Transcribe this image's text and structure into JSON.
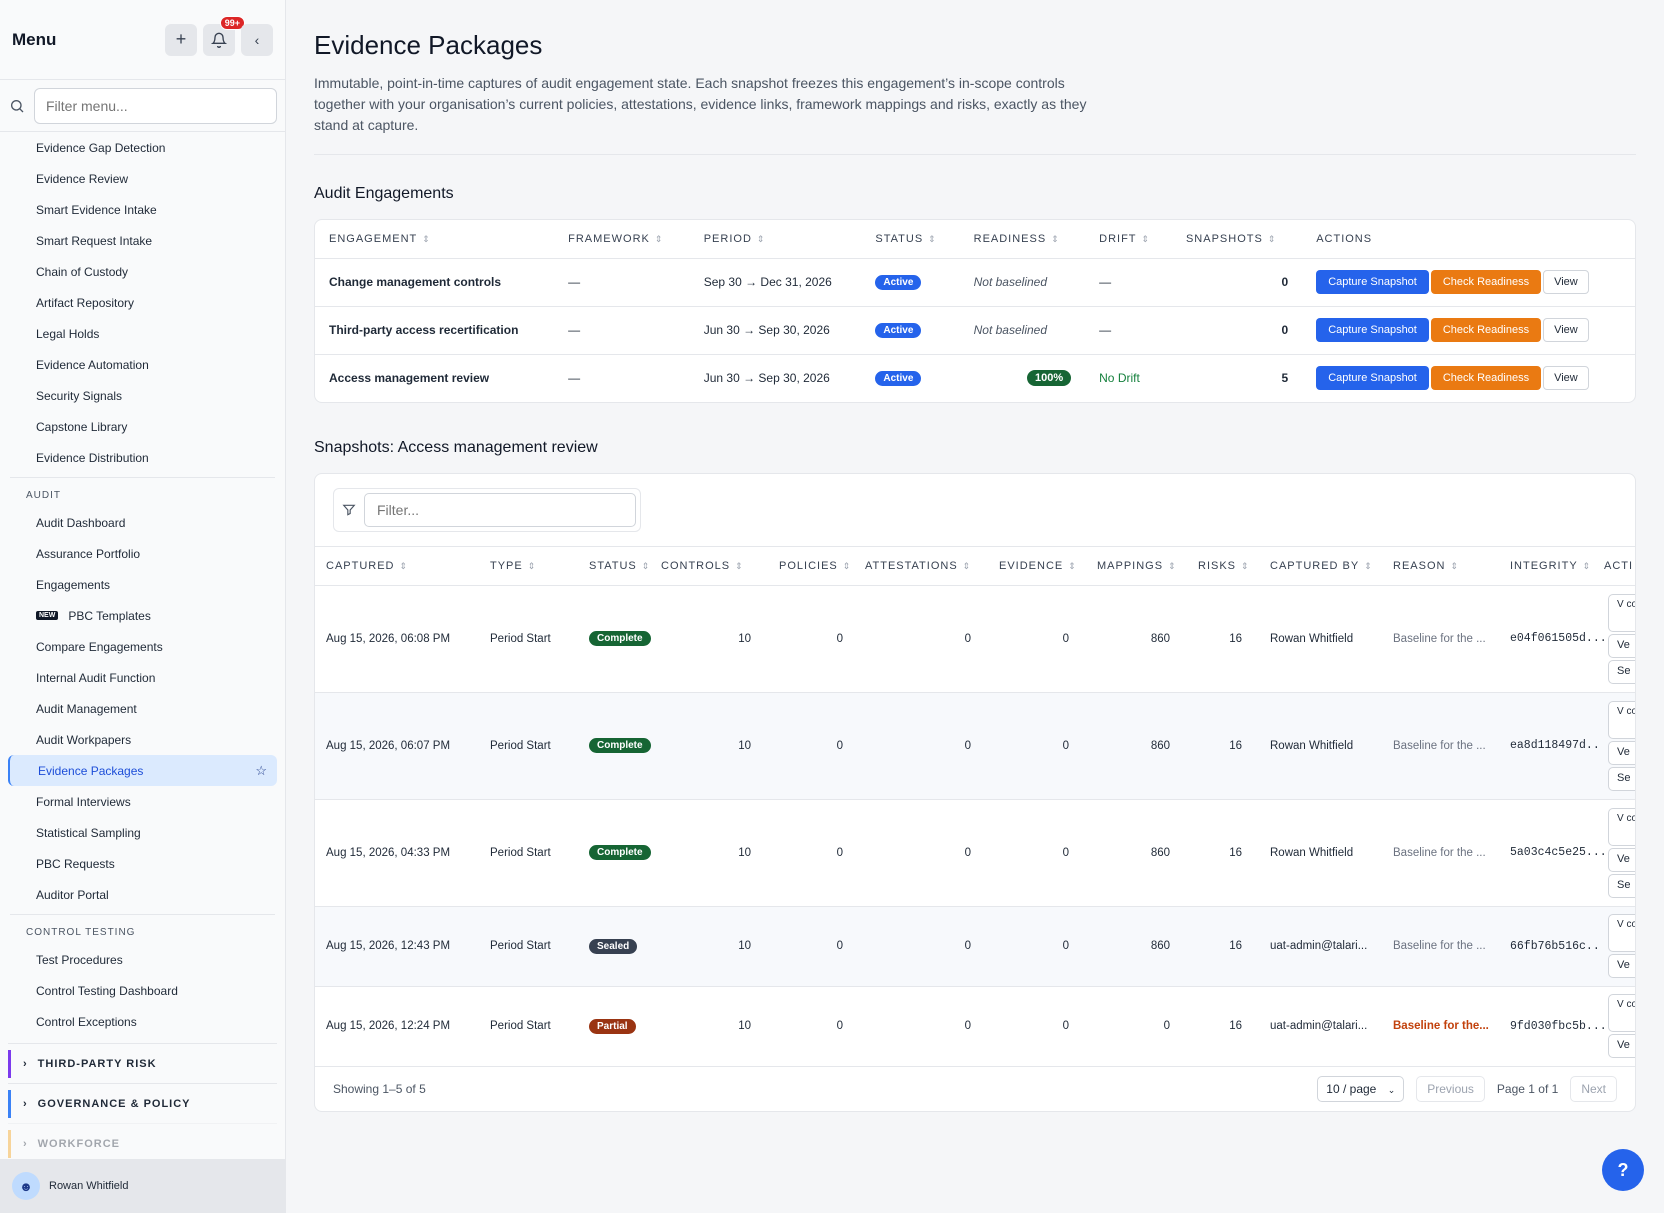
{
  "sidebar": {
    "title": "Menu",
    "badge": "99+",
    "search_placeholder": "Filter menu...",
    "items_top": [
      "Evidence Gap Detection",
      "Evidence Review",
      "Smart Evidence Intake",
      "Smart Request Intake",
      "Chain of Custody",
      "Artifact Repository",
      "Legal Holds",
      "Evidence Automation",
      "Security Signals",
      "Capstone Library",
      "Evidence Distribution"
    ],
    "audit_section": "AUDIT",
    "audit_items": [
      "Audit Dashboard",
      "Assurance Portfolio",
      "Engagements",
      "PBC Templates",
      "Compare Engagements",
      "Internal Audit Function",
      "Audit Management",
      "Audit Workpapers",
      "Evidence Packages",
      "Formal Interviews",
      "Statistical Sampling",
      "PBC Requests",
      "Auditor Portal"
    ],
    "new_tag": "NEW",
    "control_section": "CONTROL TESTING",
    "control_items": [
      "Test Procedures",
      "Control Testing Dashboard",
      "Control Exceptions"
    ],
    "groups": [
      "THIRD-PARTY RISK",
      "GOVERNANCE & POLICY",
      "WORKFORCE"
    ],
    "user": "Rowan Whitfield"
  },
  "page": {
    "title": "Evidence Packages",
    "description": "Immutable, point-in-time captures of audit engagement state. Each snapshot freezes this engagement’s in-scope controls together with your organisation’s current policies, attestations, evidence links, framework mappings and risks, exactly as they stand at capture."
  },
  "engagements": {
    "heading": "Audit Engagements",
    "columns": [
      "ENGAGEMENT",
      "FRAMEWORK",
      "PERIOD",
      "STATUS",
      "READINESS",
      "DRIFT",
      "SNAPSHOTS",
      "ACTIONS"
    ],
    "rows": [
      {
        "name": "Change management controls",
        "framework": "—",
        "period": "Sep 30 → Dec 31, 2026",
        "status": "Active",
        "readiness": "Not baselined",
        "drift": "—",
        "snapshots": "0"
      },
      {
        "name": "Third-party access recertification",
        "framework": "—",
        "period": "Jun 30 → Sep 30, 2026",
        "status": "Active",
        "readiness": "Not baselined",
        "drift": "—",
        "snapshots": "0"
      },
      {
        "name": "Access management review",
        "framework": "—",
        "period": "Jun 30 → Sep 30, 2026",
        "status": "Active",
        "readiness": "100%",
        "drift": "No Drift",
        "snapshots": "5"
      }
    ],
    "actions": {
      "capture": "Capture Snapshot",
      "check": "Check Readiness",
      "view": "View"
    }
  },
  "snapshots": {
    "heading": "Snapshots: Access management review",
    "filter_placeholder": "Filter...",
    "columns": [
      "CAPTURED",
      "TYPE",
      "STATUS",
      "CONTROLS",
      "POLICIES",
      "ATTESTATIONS",
      "EVIDENCE",
      "MAPPINGS",
      "RISKS",
      "CAPTURED BY",
      "REASON",
      "INTEGRITY",
      "ACTI"
    ],
    "rows": [
      {
        "captured": "Aug 15, 2026, 06:08 PM",
        "type": "Period Start",
        "status": "Complete",
        "controls": "10",
        "policies": "0",
        "attestations": "0",
        "evidence": "0",
        "mappings": "860",
        "risks": "16",
        "by": "Rowan Whitfield",
        "reason": "Baseline for the ...",
        "integrity": "e04f061505d...",
        "acts": [
          "V co",
          "Ve",
          "Se"
        ]
      },
      {
        "captured": "Aug 15, 2026, 06:07 PM",
        "type": "Period Start",
        "status": "Complete",
        "controls": "10",
        "policies": "0",
        "attestations": "0",
        "evidence": "0",
        "mappings": "860",
        "risks": "16",
        "by": "Rowan Whitfield",
        "reason": "Baseline for the ...",
        "integrity": "ea8d118497d...",
        "acts": [
          "V co",
          "Ve",
          "Se"
        ]
      },
      {
        "captured": "Aug 15, 2026, 04:33 PM",
        "type": "Period Start",
        "status": "Complete",
        "controls": "10",
        "policies": "0",
        "attestations": "0",
        "evidence": "0",
        "mappings": "860",
        "risks": "16",
        "by": "Rowan Whitfield",
        "reason": "Baseline for the ...",
        "integrity": "5a03c4c5e25...",
        "acts": [
          "V co",
          "Ve",
          "Se"
        ]
      },
      {
        "captured": "Aug 15, 2026, 12:43 PM",
        "type": "Period Start",
        "status": "Sealed",
        "controls": "10",
        "policies": "0",
        "attestations": "0",
        "evidence": "0",
        "mappings": "860",
        "risks": "16",
        "by": "uat-admin@talari...",
        "reason": "Baseline for the ...",
        "integrity": "66fb76b516c...",
        "acts": [
          "V co",
          "Ve"
        ]
      },
      {
        "captured": "Aug 15, 2026, 12:24 PM",
        "type": "Period Start",
        "status": "Partial",
        "controls": "10",
        "policies": "0",
        "attestations": "0",
        "evidence": "0",
        "mappings": "0",
        "risks": "16",
        "by": "uat-admin@talari...",
        "reason": "Baseline for the...",
        "integrity": "9fd030fbc5b...",
        "acts": [
          "V co",
          "Ve"
        ]
      }
    ],
    "pagination": {
      "showing": "Showing 1–5 of 5",
      "per_page": "10 / page",
      "previous": "Previous",
      "page": "Page 1 of 1",
      "next": "Next"
    }
  },
  "colors": {
    "accent": "#2563eb",
    "orange": "#ea7a12",
    "complete": "#166534",
    "partial": "#9a3412"
  }
}
